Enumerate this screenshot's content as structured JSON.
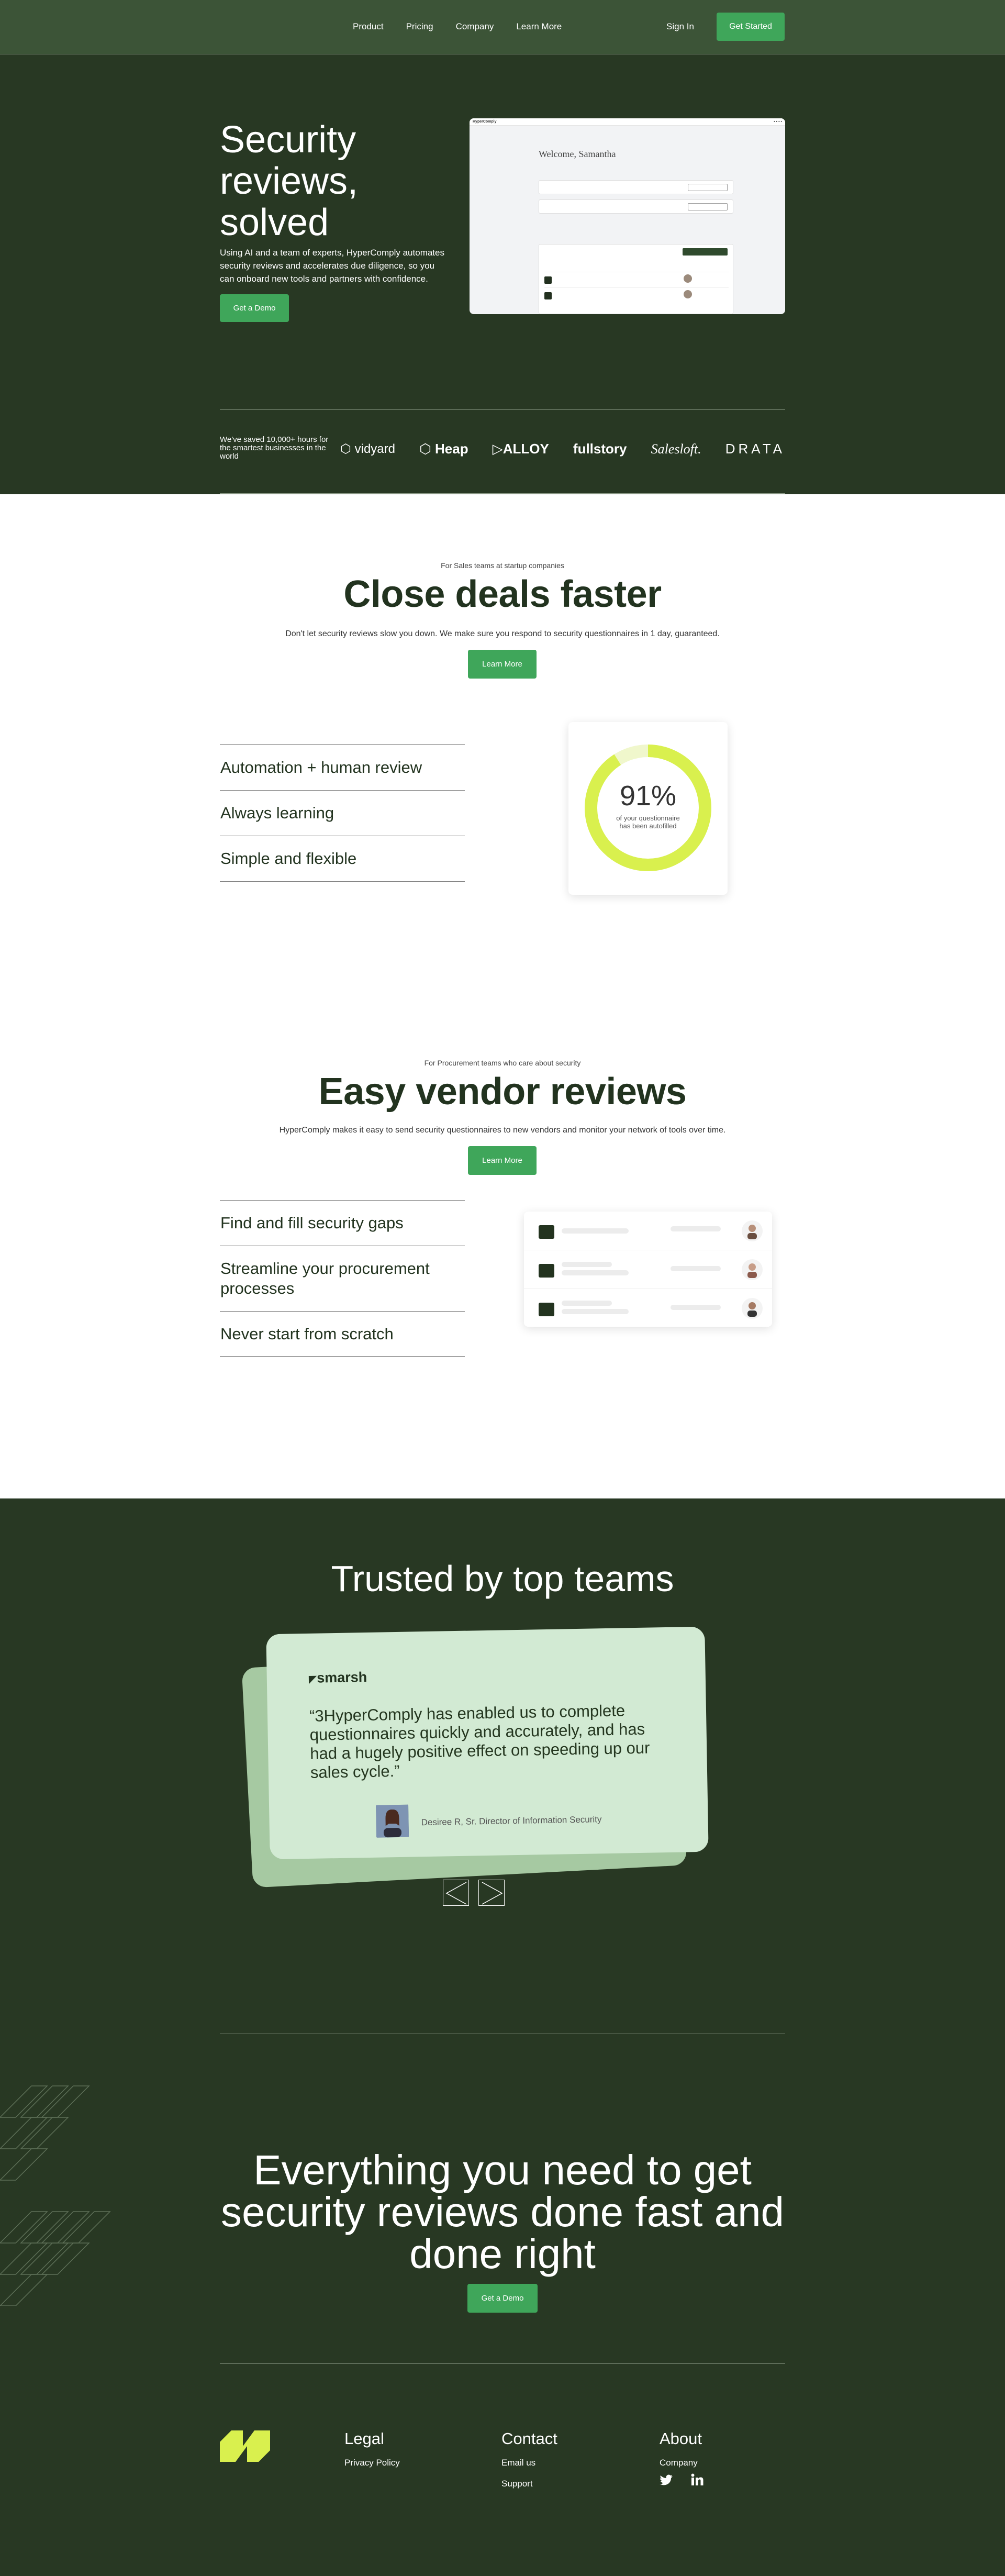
{
  "colors": {
    "dark_green": "#283823",
    "nav_green": "#3c5437",
    "accent_green": "#3fa65a",
    "lime": "#d9f04e",
    "card_mint": "#d2ead3"
  },
  "nav": {
    "links": [
      "Product",
      "Pricing",
      "Company",
      "Learn More"
    ],
    "signin": "Sign In",
    "cta": "Get Started"
  },
  "hero": {
    "title": "Security reviews, solved",
    "lead": "Using AI and a team of experts, HyperComply automates security reviews and accelerates due diligence, so you can onboard new tools and partners with confidence.",
    "cta": "Get a Demo",
    "app": {
      "brand": "HyperComply",
      "welcome": "Welcome, Samantha"
    },
    "saved_text": "We've saved 10,000+ hours for the smartest businesses in the world",
    "logos": [
      "vidyard",
      "Heap",
      "ALLOY",
      "fullstory",
      "Salesloft.",
      "DRATA"
    ]
  },
  "sales": {
    "eyebrow": "For Sales teams at startup companies",
    "title": "Close deals faster",
    "sub": "Don't let security reviews slow you down. We make sure you respond to security questionnaires in 1 day, guaranteed.",
    "cta": "Learn More",
    "features": [
      "Automation + human review",
      "Always learning",
      "Simple and flexible"
    ],
    "donut": {
      "percent": 91,
      "label": "91%",
      "caption_line1": "of your questionnaire",
      "caption_line2": "has been autofilled"
    }
  },
  "procurement": {
    "eyebrow": "For Procurement teams who care about security",
    "title": "Easy vendor reviews",
    "sub": "HyperComply makes it easy to send security questionnaires to new vendors and monitor your network of tools over time.",
    "cta": "Learn More",
    "features": [
      "Find and fill security gaps",
      "Streamline your procurement processes",
      "Never start from scratch"
    ]
  },
  "trusted": {
    "title": "Trusted by top teams",
    "brand": "smarsh",
    "quote": "“3HyperComply has enabled us to complete questionnaires quickly and accurately, and has had a hugely positive effect on speeding up our sales cycle.”",
    "author": "Desiree R, Sr. Director of Information Security"
  },
  "cta": {
    "title": "Everything you need to get security reviews done fast and done right",
    "button": "Get a Demo"
  },
  "footer": {
    "legal": {
      "heading": "Legal",
      "links": [
        "Privacy Policy"
      ]
    },
    "contact": {
      "heading": "Contact",
      "links": [
        "Email us",
        "Support"
      ]
    },
    "about": {
      "heading": "About",
      "links": [
        "Company"
      ]
    }
  }
}
